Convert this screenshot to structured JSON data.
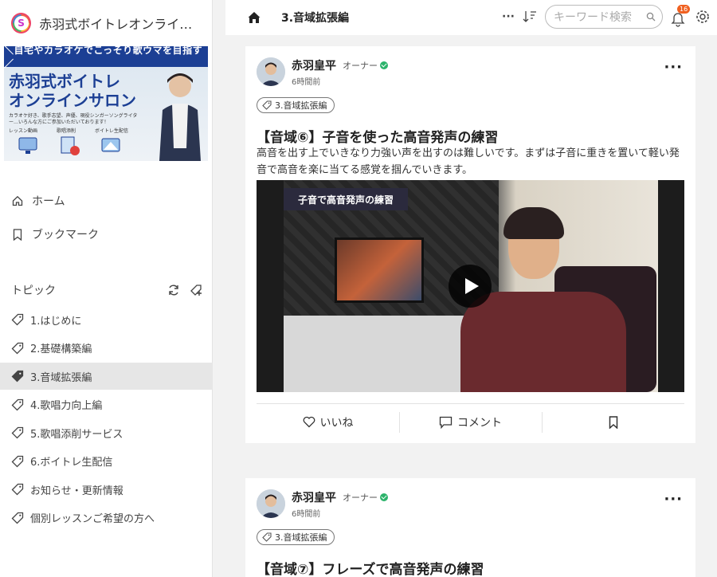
{
  "sidebar": {
    "salon_name": "赤羽式ボイトレオンラインサ...",
    "banner": {
      "tagline": "＼自宅やカラオケでこっそり歌ウマを目指す／",
      "title_line1": "赤羽式ボイトレ",
      "title_line2": "オンラインサロン",
      "sub": "カラオケ好き、歌手志望、声優、現役シンガーソングライター…いろんな方にご参加いただいております！",
      "features": "レッスン動画　　　　歌唱添削　　　　ボイトレ生配信"
    },
    "nav": [
      {
        "label": "ホーム",
        "icon": "home-icon"
      },
      {
        "label": "ブックマーク",
        "icon": "bookmark-icon"
      }
    ],
    "topics_label": "トピック",
    "topics": [
      {
        "label": "1.はじめに",
        "active": false
      },
      {
        "label": "2.基礎構築編",
        "active": false
      },
      {
        "label": "3.音域拡張編",
        "active": true
      },
      {
        "label": "4.歌唱力向上編",
        "active": false
      },
      {
        "label": "5.歌唱添削サービス",
        "active": false
      },
      {
        "label": "6.ボイトレ生配信",
        "active": false
      },
      {
        "label": "お知らせ・更新情報",
        "active": false
      },
      {
        "label": "個別レッスンご希望の方へ",
        "active": false
      }
    ]
  },
  "header": {
    "breadcrumb": "3.音域拡張編",
    "more": "···",
    "search_placeholder": "キーワード検索",
    "notification_count": "16"
  },
  "posts": [
    {
      "author": "赤羽皇平",
      "role": "オーナー",
      "time": "6時間前",
      "tag": "3.音域拡張編",
      "title": "【音域⑥】子音を使った高音発声の練習",
      "body": "高音を出す上でいきなり力強い声を出すのは難しいです。まずは子音に重きを置いて軽い発音で高音を楽に当てる感覚を掴んでいきます。",
      "video_caption": "子音で高音発声の練習",
      "like_label": "いいね",
      "comment_label": "コメント"
    },
    {
      "author": "赤羽皇平",
      "role": "オーナー",
      "time": "6時間前",
      "tag": "3.音域拡張編",
      "title": "【音域⑦】フレーズで高音発声の練習"
    }
  ],
  "colors": {
    "accent_navy": "#1c3f94",
    "verified_green": "#2cb36b",
    "badge_orange": "#f06020"
  }
}
